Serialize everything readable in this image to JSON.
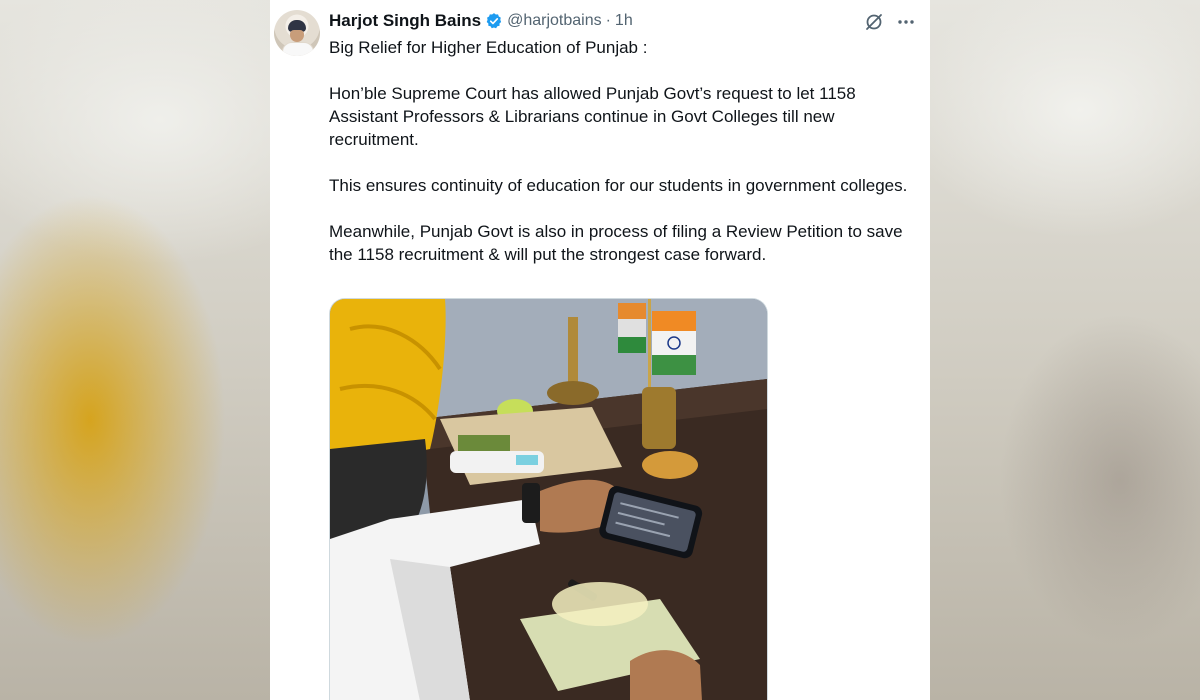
{
  "tweet": {
    "author_name": "Harjot Singh Bains",
    "handle": "@harjotbains",
    "separator": "·",
    "timestamp": "1h",
    "paragraphs": [
      "Big Relief for Higher Education of Punjab :",
      "Hon’ble Supreme Court has allowed Punjab Govt’s request to let 1158 Assistant Professors & Librarians continue in Govt Colleges till new recruitment.",
      "This ensures continuity of education for our students in government colleges.",
      "Meanwhile, Punjab Govt is also in process of filing a Review Petition to save the 1158 recruitment & will put the strongest case forward."
    ]
  },
  "icons": {
    "verified": "verified-badge-icon",
    "grok": "grok-icon",
    "more": "more-options-icon"
  },
  "colors": {
    "verified_blue": "#1d9bf0",
    "text_primary": "#0f1419",
    "text_secondary": "#536471",
    "turban_yellow": "#e9b30b"
  }
}
